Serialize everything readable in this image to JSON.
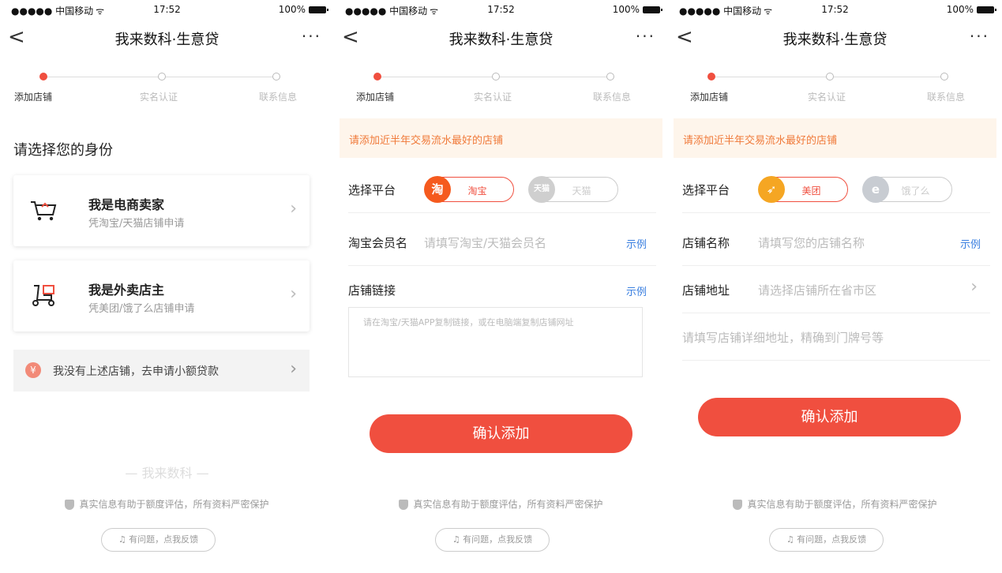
{
  "status": {
    "carrier": "●●●●● 中国移动",
    "wifi": "ᯤ",
    "time": "17:52",
    "battery": "100%"
  },
  "nav": {
    "back": "<",
    "title": "我来数科·生意贷",
    "more": "···"
  },
  "steps": [
    "添加店铺",
    "实名认证",
    "联系信息"
  ],
  "screen1": {
    "heading": "请选择您的身份",
    "card1": {
      "title": "我是电商卖家",
      "sub": "凭淘宝/天猫店铺申请"
    },
    "card2": {
      "title": "我是外卖店主",
      "sub": "凭美团/饿了么店铺申请"
    },
    "alt": {
      "icon": "¥",
      "text": "我没有上述店铺，去申请小额贷款"
    },
    "brand": "— 我来数科 —"
  },
  "screen2": {
    "notice": "请添加近半年交易流水最好的店铺",
    "platform_label": "选择平台",
    "platform1": {
      "icon": "淘",
      "label": "淘宝"
    },
    "platform2": {
      "icon": "天猫",
      "label": "天猫"
    },
    "member_label": "淘宝会员名",
    "member_placeholder": "请填写淘宝/天猫会员名",
    "example": "示例",
    "link_label": "店铺链接",
    "link_placeholder": "请在淘宝/天猫APP复制链接，或在电脑端复制店铺网址",
    "confirm": "确认添加"
  },
  "screen3": {
    "notice": "请添加近半年交易流水最好的店铺",
    "platform_label": "选择平台",
    "platform1": {
      "icon": "➶",
      "label": "美团"
    },
    "platform2": {
      "icon": "e",
      "label": "饿了么"
    },
    "name_label": "店铺名称",
    "name_placeholder": "请填写您的店铺名称",
    "example": "示例",
    "addr_label": "店铺地址",
    "addr_placeholder": "请选择店铺所在省市区",
    "detail_placeholder": "请填写店铺详细地址，精确到门牌号等",
    "confirm": "确认添加"
  },
  "footer": {
    "secure": "真实信息有助于额度评估，所有资料严密保护",
    "feedback": "有问题，点我反馈"
  },
  "colors": {
    "accent": "#f04f3f",
    "notice_bg": "#fef5eb",
    "notice_text": "#f07a3a",
    "link": "#3a7fe0",
    "taobao": "#f55a1e",
    "tmall": "#cfcfcf",
    "meituan": "#f5a623",
    "eleme": "#c8ccd2"
  }
}
